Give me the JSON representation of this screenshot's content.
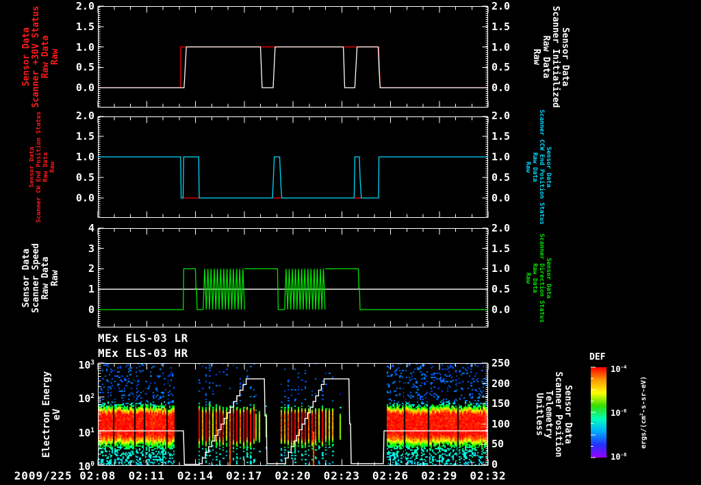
{
  "titles": {
    "lr": "MEx ELS-03 LR",
    "hr": "MEx ELS-03 HR"
  },
  "x_axis": {
    "first_label": "2009/225 02:08",
    "first_label_time": 0,
    "labels": [
      [
        3,
        "02:11"
      ],
      [
        6,
        "02:14"
      ],
      [
        9,
        "02:17"
      ],
      [
        12,
        "02:20"
      ],
      [
        15,
        "02:23"
      ],
      [
        18,
        "02:26"
      ],
      [
        21,
        "02:29"
      ],
      [
        24,
        "02:32"
      ]
    ],
    "start": "02:08",
    "end": "02:32",
    "minutes_span": 24
  },
  "colors": {
    "red": "#ff0000",
    "white": "#ffffff",
    "cyan": "#00d9ff",
    "green": "#00e400",
    "bg": "#000000"
  },
  "chart_data": [
    {
      "type": "line",
      "left_label": {
        "lines": [
          "Sensor Data",
          "Scanner +30V Status",
          "Raw Data",
          "Raw"
        ],
        "color": "#ff1a1a",
        "size": 13
      },
      "right_label": {
        "lines": [
          "Sensor Data",
          "Scanner Initialized",
          "Raw Data",
          "Raw"
        ],
        "color": "#ffffff",
        "size": 13
      },
      "ylim": [
        -0.5,
        2.05
      ],
      "xlim": [
        0,
        24
      ],
      "yticks": [
        [
          "0.0",
          0
        ],
        [
          "0.5",
          0.5
        ],
        [
          "1.0",
          1
        ],
        [
          "1.5",
          1.5
        ],
        [
          "2.0",
          2
        ]
      ],
      "series": [
        {
          "name": "scanner-30v-status",
          "color": "#ff0000",
          "segments": [
            {
              "pts": [
                [
                  0,
                  0
                ],
                [
                  5.09,
                  0
                ],
                [
                  5.09,
                  1
                ],
                [
                  17.28,
                  1
                ],
                [
                  17.36,
                  0
                ],
                [
                  24,
                  0
                ]
              ]
            }
          ]
        },
        {
          "name": "scanner-initialized",
          "color": "#ffffff",
          "segments": [
            {
              "pts": [
                [
                  0,
                  0
                ],
                [
                  5.3,
                  0
                ],
                [
                  5.44,
                  1
                ],
                [
                  10.0,
                  1
                ],
                [
                  10.1,
                  0
                ],
                [
                  10.78,
                  0
                ],
                [
                  10.9,
                  1
                ],
                [
                  15.1,
                  1
                ],
                [
                  15.18,
                  0
                ],
                [
                  15.8,
                  0
                ],
                [
                  15.94,
                  1
                ],
                [
                  17.24,
                  1
                ],
                [
                  17.3,
                  0.4
                ],
                [
                  17.36,
                  0
                ],
                [
                  24,
                  0
                ]
              ]
            }
          ]
        }
      ]
    },
    {
      "type": "line",
      "left_label": {
        "lines": [
          "Sensor Data",
          "Scanner CW End Position Status",
          "Raw Data",
          "Raw"
        ],
        "color": "#ff1a1a",
        "size": 9
      },
      "right_label": {
        "lines": [
          "Sensor Data",
          "Scanner CCW End Position Status",
          "Raw Data",
          "Raw"
        ],
        "color": "#00d9ff",
        "size": 9
      },
      "ylim": [
        -0.5,
        2.05
      ],
      "xlim": [
        0,
        24
      ],
      "yticks": [
        [
          "0.0",
          0
        ],
        [
          "0.5",
          0.5
        ],
        [
          "1.0",
          1
        ],
        [
          "1.5",
          1.5
        ],
        [
          "2.0",
          2
        ]
      ],
      "series": [
        {
          "name": "scanner-cw-end-position",
          "color": "#ff0000",
          "segments": [
            {
              "pts": [
                [
                  5.28,
                  0
                ],
                [
                  6.23,
                  0
                ]
              ]
            },
            {
              "pts": [
                [
                  10.78,
                  0
                ],
                [
                  11.31,
                  0
                ]
              ]
            },
            {
              "pts": [
                [
                  15.78,
                  0
                ],
                [
                  16.2,
                  0
                ]
              ]
            }
          ]
        },
        {
          "name": "scanner-ccw-end-position",
          "color": "#00d9ff",
          "segments": [
            {
              "pts": [
                [
                  0,
                  1
                ],
                [
                  5.09,
                  1
                ],
                [
                  5.12,
                  0
                ],
                [
                  5.24,
                  0
                ],
                [
                  5.28,
                  1
                ],
                [
                  6.2,
                  1
                ],
                [
                  6.23,
                  0
                ],
                [
                  10.74,
                  0
                ],
                [
                  10.8,
                  0.55
                ],
                [
                  10.85,
                  1
                ],
                [
                  11.18,
                  1
                ],
                [
                  11.25,
                  0.35
                ],
                [
                  11.31,
                  0
                ],
                [
                  15.76,
                  0
                ],
                [
                  15.8,
                  1
                ],
                [
                  16.08,
                  1
                ],
                [
                  16.13,
                  0.45
                ],
                [
                  16.2,
                  0
                ],
                [
                  17.26,
                  0
                ],
                [
                  17.29,
                  1
                ],
                [
                  24,
                  1
                ]
              ]
            }
          ]
        }
      ]
    },
    {
      "type": "line",
      "left_label": {
        "lines": [
          "Sensor Data",
          "Scanner Speed",
          "Raw Data",
          "Raw"
        ],
        "color": "#ffffff",
        "size": 13
      },
      "right_label": {
        "lines": [
          "Sensor Data",
          "Scanner Direction Status",
          "Raw Data",
          "Raw"
        ],
        "color": "#00e400",
        "size": 9
      },
      "ylim": [
        -0.85,
        4.05
      ],
      "xlim": [
        0,
        24
      ],
      "yticks": [
        [
          "0",
          0
        ],
        [
          "1",
          1
        ],
        [
          "2",
          2
        ],
        [
          "3",
          3
        ],
        [
          "4",
          4
        ]
      ],
      "yticks_right": [
        [
          "0.0",
          0
        ],
        [
          "0.5",
          0.5
        ],
        [
          "1.0",
          1
        ],
        [
          "1.5",
          1.5
        ],
        [
          "2.0",
          2
        ]
      ],
      "series": [
        {
          "name": "reference-line",
          "color": "#ffffff",
          "segments": [
            {
              "pts": [
                [
                  0,
                  1
                ],
                [
                  24,
                  1
                ]
              ]
            }
          ]
        },
        {
          "name": "scanner-speed",
          "color": "#00e400",
          "segments": [
            {
              "pts": [
                [
                  0,
                  0
                ],
                [
                  5.25,
                  0
                ],
                [
                  5.28,
                  2
                ],
                [
                  6.0,
                  2
                ],
                [
                  6.03,
                  1.05
                ],
                [
                  6.07,
                  1.05
                ],
                [
                  6.1,
                  0
                ],
                [
                  6.47,
                  0
                ]
              ]
            },
            {
              "osc": {
                "t0": 6.47,
                "t1": 9.02,
                "cycles": 13,
                "lo": 0,
                "hi": 2
              }
            },
            {
              "pts": [
                [
                  9.02,
                  2
                ],
                [
                  11.05,
                  2
                ],
                [
                  11.09,
                  0
                ],
                [
                  11.48,
                  0
                ]
              ]
            },
            {
              "osc": {
                "t0": 11.48,
                "t1": 13.97,
                "cycles": 13,
                "lo": 0,
                "hi": 2
              }
            },
            {
              "pts": [
                [
                  13.97,
                  2
                ],
                [
                  16.02,
                  2
                ],
                [
                  16.05,
                  1.05
                ],
                [
                  16.09,
                  1.05
                ],
                [
                  16.12,
                  0
                ],
                [
                  24,
                  0
                ]
              ]
            }
          ]
        }
      ]
    },
    {
      "type": "heatmap",
      "left_label": {
        "lines": [
          "Electron Energy",
          "eV"
        ],
        "color": "#ffffff",
        "size": 14
      },
      "right_label": {
        "lines": [
          "Sensor Data",
          "Scanner Position",
          "Telemetry",
          "Unitless"
        ],
        "color": "#ffffff",
        "size": 13
      },
      "ylog_ticks": [
        3,
        2,
        1,
        0
      ],
      "right_ticks": [
        [
          "250",
          250
        ],
        [
          "200",
          200
        ],
        [
          "150",
          150
        ],
        [
          "100",
          100
        ],
        [
          "50",
          50
        ],
        [
          "0",
          0
        ]
      ],
      "xlim": [
        0,
        24
      ],
      "energy_range_ev": [
        1,
        1000
      ],
      "intense_band_ev": [
        7,
        35
      ],
      "segments": [
        {
          "type": "dense",
          "t0": 0,
          "t1": 4.72
        },
        {
          "type": "striped",
          "t0": 6.18,
          "t1": 9.7
        },
        {
          "type": "sparse",
          "t0": 9.7,
          "t1": 10.35
        },
        {
          "type": "striped",
          "t0": 11.23,
          "t1": 14.46
        },
        {
          "type": "sparse",
          "t0": 14.46,
          "t1": 15.05
        },
        {
          "type": "dense",
          "t0": 17.76,
          "t1": 24
        }
      ],
      "grid_gaps_t": [
        0.93,
        2.23,
        2.82,
        4.21,
        18.8,
        20.3,
        22.1
      ],
      "hot_columns_t": [
        8.07,
        13.2
      ],
      "position_trace": {
        "name": "scanner-position-telemetry",
        "color": "#ffffff",
        "scale": [
          0,
          250
        ],
        "segments": [
          {
            "pts": [
              [
                0,
                83
              ],
              [
                5.26,
                83
              ],
              [
                5.32,
                0
              ],
              [
                6.23,
                0
              ]
            ]
          },
          {
            "ramp": {
              "t0": 6.23,
              "t1": 9.12,
              "v0": 2,
              "v1": 211,
              "steps": 15
            }
          },
          {
            "pts": [
              [
                9.12,
                211
              ],
              [
                10.24,
                211
              ],
              [
                10.28,
                120
              ],
              [
                10.36,
                120
              ],
              [
                10.4,
                2
              ],
              [
                11.38,
                2
              ]
            ]
          },
          {
            "ramp": {
              "t0": 11.38,
              "t1": 13.91,
              "v0": 2,
              "v1": 211,
              "steps": 15
            }
          },
          {
            "pts": [
              [
                13.91,
                211
              ],
              [
                15.44,
                211
              ],
              [
                15.48,
                100
              ],
              [
                15.54,
                100
              ],
              [
                15.58,
                2
              ],
              [
                17.56,
                2
              ],
              [
                17.6,
                83
              ],
              [
                24,
                83
              ]
            ]
          }
        ]
      },
      "colorbar": {
        "title": "DEF",
        "ticks": [
          {
            "base": "10",
            "exp": "-4"
          },
          {
            "base": "10",
            "exp": "-6"
          },
          {
            "base": "10",
            "exp": "-8"
          }
        ],
        "unit_parts": [
          "ergs/(cm",
          "2",
          "-s-sr-eV)"
        ],
        "colors": [
          "#ff0000",
          "#ff9900",
          "#ffff00",
          "#33dd00",
          "#00ffbb",
          "#00aaff",
          "#2233ff",
          "#9900ff"
        ]
      }
    }
  ]
}
